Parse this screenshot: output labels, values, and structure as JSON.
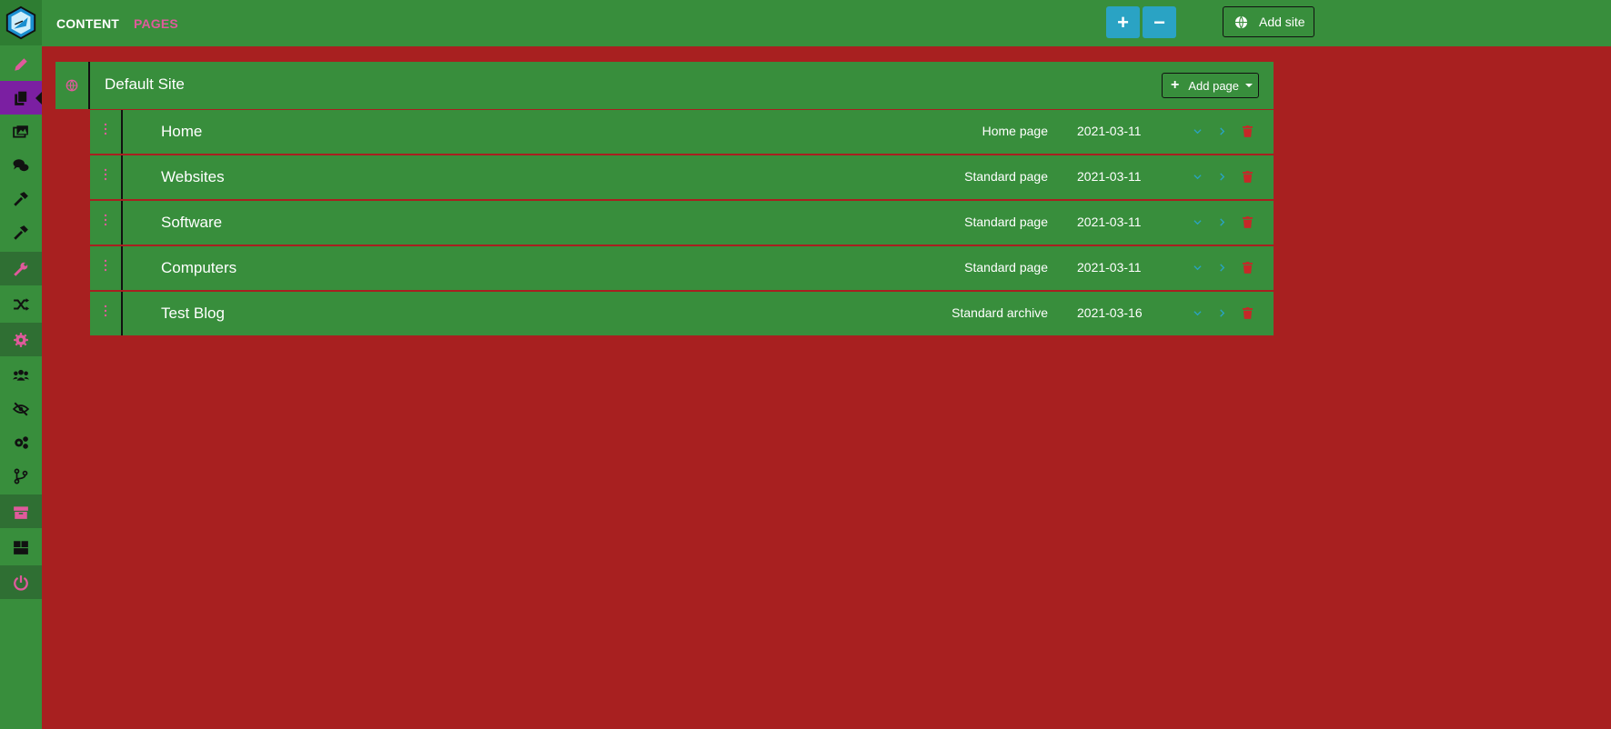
{
  "topbar": {
    "crumbs": [
      "CONTENT",
      "PAGES"
    ],
    "expand_label": "+",
    "collapse_label": "−",
    "add_site_label": "Add site"
  },
  "sidebar": {
    "items": [
      {
        "icon": "pencil-icon"
      },
      {
        "icon": "pages-icon",
        "active": true
      },
      {
        "icon": "image-icon"
      },
      {
        "icon": "comments-icon"
      },
      {
        "icon": "hammer-icon"
      },
      {
        "icon": "hammer-icon"
      },
      {
        "icon": "wrench-icon"
      },
      {
        "icon": "random-icon"
      },
      {
        "icon": "cog-icon"
      },
      {
        "icon": "users-icon"
      },
      {
        "icon": "eye-slash-icon"
      },
      {
        "icon": "cogs-icon"
      },
      {
        "icon": "branch-icon"
      },
      {
        "icon": "box-icon"
      },
      {
        "icon": "boxes-icon"
      },
      {
        "icon": "power-icon"
      }
    ]
  },
  "site": {
    "title": "Default Site",
    "add_page_label": "Add page"
  },
  "pages": [
    {
      "title": "Home",
      "type": "Home page",
      "date": "2021-03-11"
    },
    {
      "title": "Websites",
      "type": "Standard page",
      "date": "2021-03-11"
    },
    {
      "title": "Software",
      "type": "Standard page",
      "date": "2021-03-11"
    },
    {
      "title": "Computers",
      "type": "Standard page",
      "date": "2021-03-11"
    },
    {
      "title": "Test Blog",
      "type": "Standard archive",
      "date": "2021-03-16"
    }
  ],
  "colors": {
    "background": "#a82020",
    "panel": "#388e3c",
    "accent_blue": "#2aa3c4",
    "pink": "#e05a9c",
    "active": "#7b1fa2",
    "delete": "#c62828"
  }
}
